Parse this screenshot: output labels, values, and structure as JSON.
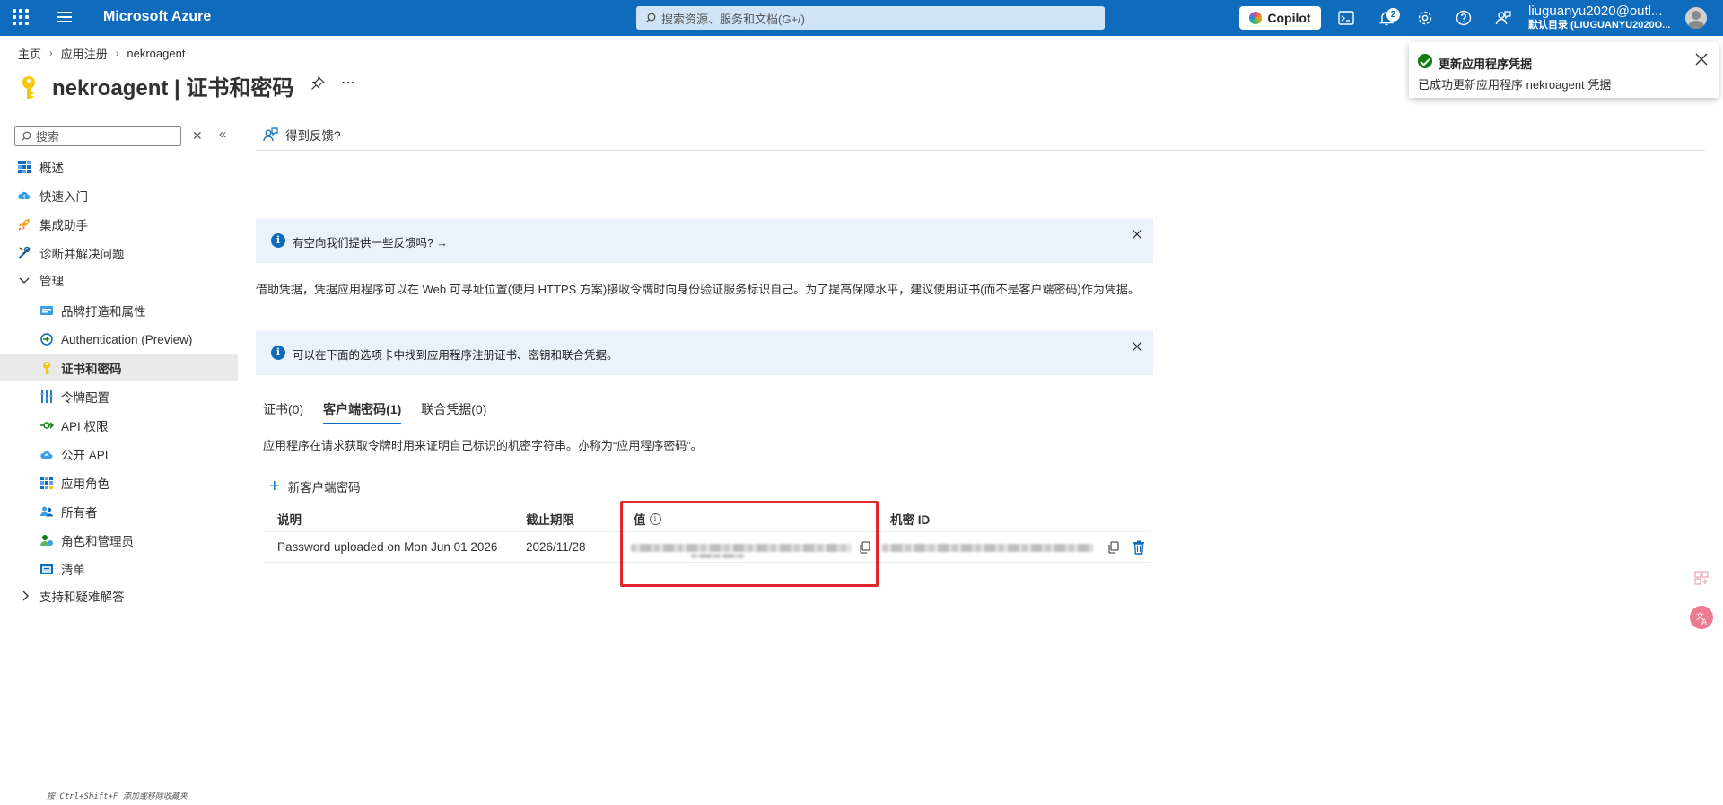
{
  "topbar": {
    "brand": "Microsoft Azure",
    "search_placeholder": "搜索资源、服务和文档(G+/)",
    "copilot_label": "Copilot",
    "notification_count": "2",
    "account_name": "liuguanyu2020@outl...",
    "account_directory": "默认目录 (LIUGUANYU2020O...",
    "colors": {
      "bar": "#0f6cbd"
    }
  },
  "breadcrumb": {
    "items": [
      "主页",
      "应用注册",
      "nekroagent"
    ]
  },
  "page": {
    "title": "nekroagent | 证书和密码"
  },
  "toast": {
    "title": "更新应用程序凭据",
    "message": "已成功更新应用程序 nekroagent 凭据"
  },
  "sidebar": {
    "search_placeholder": "搜索",
    "items": [
      {
        "label": "概述",
        "icon": "overview-grid-icon"
      },
      {
        "label": "快速入门",
        "icon": "cloud-lightning-icon"
      },
      {
        "label": "集成助手",
        "icon": "rocket-icon"
      },
      {
        "label": "诊断并解决问题",
        "icon": "wrench-icon"
      },
      {
        "label": "管理",
        "icon": "chevron-down-icon",
        "group": true
      },
      {
        "label": "品牌打造和属性",
        "icon": "branding-card-icon"
      },
      {
        "label": "Authentication (Preview)",
        "icon": "authentication-icon"
      },
      {
        "label": "证书和密码",
        "icon": "key-icon",
        "active": true
      },
      {
        "label": "令牌配置",
        "icon": "token-sliders-icon"
      },
      {
        "label": "API 权限",
        "icon": "api-permissions-icon"
      },
      {
        "label": "公开 API",
        "icon": "cloud-api-icon"
      },
      {
        "label": "应用角色",
        "icon": "app-roles-grid-icon"
      },
      {
        "label": "所有者",
        "icon": "owners-icon"
      },
      {
        "label": "角色和管理员",
        "icon": "roles-admins-icon"
      },
      {
        "label": "清单",
        "icon": "manifest-icon"
      },
      {
        "label": "支持和疑难解答",
        "icon": "chevron-right-icon",
        "group": true
      }
    ]
  },
  "main": {
    "feedback_label": "得到反馈?",
    "banner1": "有空向我们提供一些反馈吗? →",
    "description": "借助凭据，凭据应用程序可以在 Web 可寻址位置(使用 HTTPS 方案)接收令牌时向身份验证服务标识自己。为了提高保障水平，建议使用证书(而不是客户端密码)作为凭据。",
    "banner2": "可以在下面的选项卡中找到应用程序注册证书、密钥和联合凭据。",
    "tabs": [
      {
        "label": "证书(0)",
        "active": false
      },
      {
        "label": "客户端密码(1)",
        "active": true
      },
      {
        "label": "联合凭据(0)",
        "active": false
      }
    ],
    "tab_description": "应用程序在请求获取令牌时用来证明自己标识的机密字符串。亦称为“应用程序密码”。",
    "new_secret_label": "新客户端密码",
    "table": {
      "headers": [
        "说明",
        "截止期限",
        "值",
        "机密 ID"
      ],
      "rows": [
        {
          "description": "Password uploaded on Mon Jun 01 2026",
          "expires": "2026/11/28"
        }
      ]
    }
  },
  "footer_hint": "按 Ctrl+Shift+F 添加或移除收藏夹"
}
